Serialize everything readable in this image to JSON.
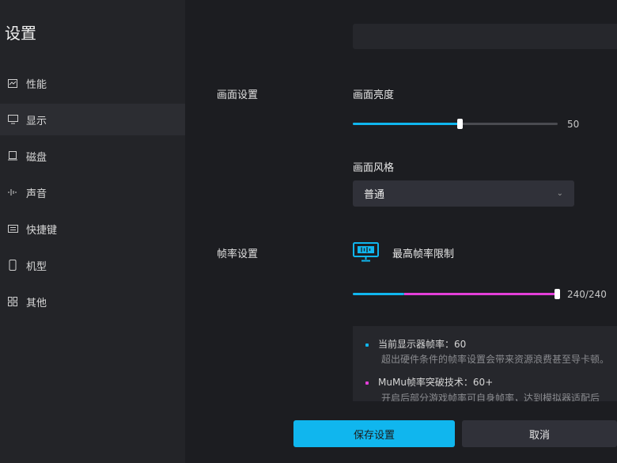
{
  "sidebar": {
    "title": "设置",
    "items": [
      {
        "label": "性能",
        "icon": "performance-icon"
      },
      {
        "label": "显示",
        "icon": "monitor-icon"
      },
      {
        "label": "磁盘",
        "icon": "disk-icon"
      },
      {
        "label": "声音",
        "icon": "sound-icon"
      },
      {
        "label": "快捷键",
        "icon": "keyboard-icon"
      },
      {
        "label": "机型",
        "icon": "phone-icon"
      },
      {
        "label": "其他",
        "icon": "grid-icon"
      }
    ],
    "active_index": 1
  },
  "display": {
    "section_label": "画面设置",
    "brightness_label": "画面亮度",
    "brightness_value": "50",
    "brightness_fraction": 0.5,
    "style_label": "画面风格",
    "style_value": "普通"
  },
  "framerate": {
    "section_label": "帧率设置",
    "max_label": "最高帧率限制",
    "max_value": "240/240",
    "max_fraction": 1.0,
    "native_fraction": 0.25,
    "info": [
      {
        "title": "当前显示器帧率：60",
        "desc": "超出硬件条件的帧率设置会带来资源浪费甚至导卡顿。",
        "color": "#10b6ee"
      },
      {
        "title": "MuMu帧率突破技术：60+",
        "desc": "开启后部分游戏帧率可自身帧率，达到模拟器适配后",
        "color": "#e33fd9"
      }
    ]
  },
  "buttons": {
    "save": "保存设置",
    "cancel": "取消"
  },
  "colors": {
    "accent": "#10b6ee",
    "magenta": "#e33fd9"
  }
}
